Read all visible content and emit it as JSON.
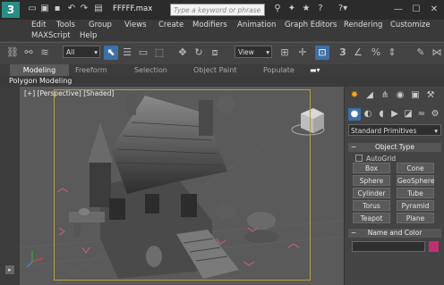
{
  "title_bar": {
    "app_logo": "3",
    "file_title": "FFFFF.max",
    "search_placeholder": "Type a keyword or phrase"
  },
  "menu": {
    "items": [
      "Edit",
      "Tools",
      "Group",
      "Views",
      "Create",
      "Modifiers",
      "Animation",
      "Graph Editors",
      "Rendering",
      "Customize",
      "MAXScript",
      "Help"
    ]
  },
  "toolbar": {
    "selection_filter": "All",
    "ref_coord": "View",
    "snap_label": "3"
  },
  "ribbon": {
    "tabs": [
      "Modeling",
      "Freeform",
      "Selection",
      "Object Paint",
      "Populate"
    ],
    "active_tab": "Modeling",
    "sub_label": "Polygon Modeling"
  },
  "viewport": {
    "label": "[+] [Perspective] [Shaded]"
  },
  "command_panel": {
    "category": "Standard Primitives",
    "object_type": {
      "header": "Object Type",
      "autogrid": "AutoGrid",
      "buttons": [
        "Box",
        "Cone",
        "Sphere",
        "GeoSphere",
        "Cylinder",
        "Tube",
        "Torus",
        "Pyramid",
        "Teapot",
        "Plane"
      ]
    },
    "name_and_color": {
      "header": "Name and Color",
      "color": "#c0306e"
    }
  }
}
